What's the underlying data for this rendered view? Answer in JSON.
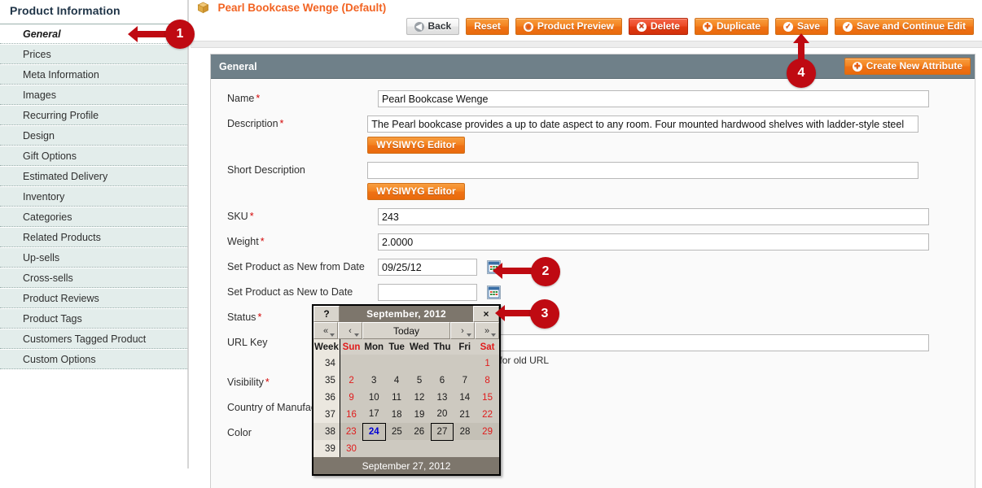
{
  "sidebar": {
    "title": "Product Information",
    "items": [
      {
        "label": "General",
        "active": true
      },
      {
        "label": "Prices",
        "active": false
      },
      {
        "label": "Meta Information",
        "active": false
      },
      {
        "label": "Images",
        "active": false
      },
      {
        "label": "Recurring Profile",
        "active": false
      },
      {
        "label": "Design",
        "active": false
      },
      {
        "label": "Gift Options",
        "active": false
      },
      {
        "label": "Estimated Delivery",
        "active": false
      },
      {
        "label": "Inventory",
        "active": false
      },
      {
        "label": "Categories",
        "active": false
      },
      {
        "label": "Related Products",
        "active": false
      },
      {
        "label": "Up-sells",
        "active": false
      },
      {
        "label": "Cross-sells",
        "active": false
      },
      {
        "label": "Product Reviews",
        "active": false
      },
      {
        "label": "Product Tags",
        "active": false
      },
      {
        "label": "Customers Tagged Product",
        "active": false
      },
      {
        "label": "Custom Options",
        "active": false
      }
    ]
  },
  "header": {
    "title": "Pearl Bookcase Wenge (Default)",
    "icon": "box-icon",
    "title_color": "#f26322"
  },
  "toolbar": {
    "buttons": [
      {
        "label": "Back",
        "style": "gray",
        "icon": "back-circle-icon"
      },
      {
        "label": "Reset",
        "style": "orange",
        "icon": ""
      },
      {
        "label": "Product Preview",
        "style": "orange",
        "icon": "eye-icon"
      },
      {
        "label": "Delete",
        "style": "red",
        "icon": "x-circle-icon"
      },
      {
        "label": "Duplicate",
        "style": "orange",
        "icon": "plus-circle-icon"
      },
      {
        "label": "Save",
        "style": "orange",
        "icon": "check-circle-icon"
      },
      {
        "label": "Save and Continue Edit",
        "style": "orange",
        "icon": "check-circle-icon"
      }
    ]
  },
  "panel": {
    "title": "General",
    "create_attribute_label": "Create New Attribute",
    "header_bg": "#6f8089"
  },
  "form": {
    "name": {
      "label": "Name",
      "required": true,
      "value": "Pearl Bookcase Wenge"
    },
    "description": {
      "label": "Description",
      "required": true,
      "value": "The Pearl bookcase provides a up to date aspect to any room. Four mounted hardwood shelves with ladder-style steel",
      "editor_label": "WYSIWYG Editor"
    },
    "short_description": {
      "label": "Short Description",
      "required": false,
      "value": "",
      "editor_label": "WYSIWYG Editor"
    },
    "sku": {
      "label": "SKU",
      "required": true,
      "value": "243"
    },
    "weight": {
      "label": "Weight",
      "required": true,
      "value": "2.0000"
    },
    "new_from_date": {
      "label": "Set Product as New from Date",
      "required": false,
      "value": "09/25/12"
    },
    "new_to_date": {
      "label": "Set Product as New to Date",
      "required": false,
      "value": ""
    },
    "status": {
      "label": "Status",
      "required": true,
      "value": ""
    },
    "url_key": {
      "label": "URL Key",
      "required": false,
      "value": "",
      "hint": "Create Permanent Redirect for old URL"
    },
    "visibility": {
      "label": "Visibility",
      "required": true,
      "value": ""
    },
    "country_of_manufacture": {
      "label": "Country of Manufacture",
      "required": false,
      "value": ""
    },
    "color": {
      "label": "Color",
      "required": false,
      "value": ""
    }
  },
  "calendar": {
    "help_label": "?",
    "close_label": "×",
    "month_title": "September, 2012",
    "nav": {
      "prev_year": "«",
      "prev_month": "‹",
      "today": "Today",
      "next_month": "›",
      "next_year": "»"
    },
    "week_header": "Week",
    "day_headers": [
      "Sun",
      "Mon",
      "Tue",
      "Wed",
      "Thu",
      "Fri",
      "Sat"
    ],
    "weeks": [
      {
        "week": "34",
        "days": [
          "",
          "",
          "",
          "",
          "",
          "",
          "1"
        ]
      },
      {
        "week": "35",
        "days": [
          "2",
          "3",
          "4",
          "5",
          "6",
          "7",
          "8"
        ]
      },
      {
        "week": "36",
        "days": [
          "9",
          "10",
          "11",
          "12",
          "13",
          "14",
          "15"
        ]
      },
      {
        "week": "37",
        "days": [
          "16",
          "17",
          "18",
          "19",
          "20",
          "21",
          "22"
        ]
      },
      {
        "week": "38",
        "days": [
          "23",
          "24",
          "25",
          "26",
          "27",
          "28",
          "29"
        ],
        "highlight": true
      },
      {
        "week": "39",
        "days": [
          "30",
          "",
          "",
          "",
          "",
          "",
          ""
        ]
      }
    ],
    "selected_day": "24",
    "today_day": "27",
    "footer": "September 27, 2012"
  },
  "annotations": [
    {
      "number": "1",
      "direction": "left"
    },
    {
      "number": "2",
      "direction": "left"
    },
    {
      "number": "3",
      "direction": "left"
    },
    {
      "number": "4",
      "direction": "up"
    }
  ]
}
